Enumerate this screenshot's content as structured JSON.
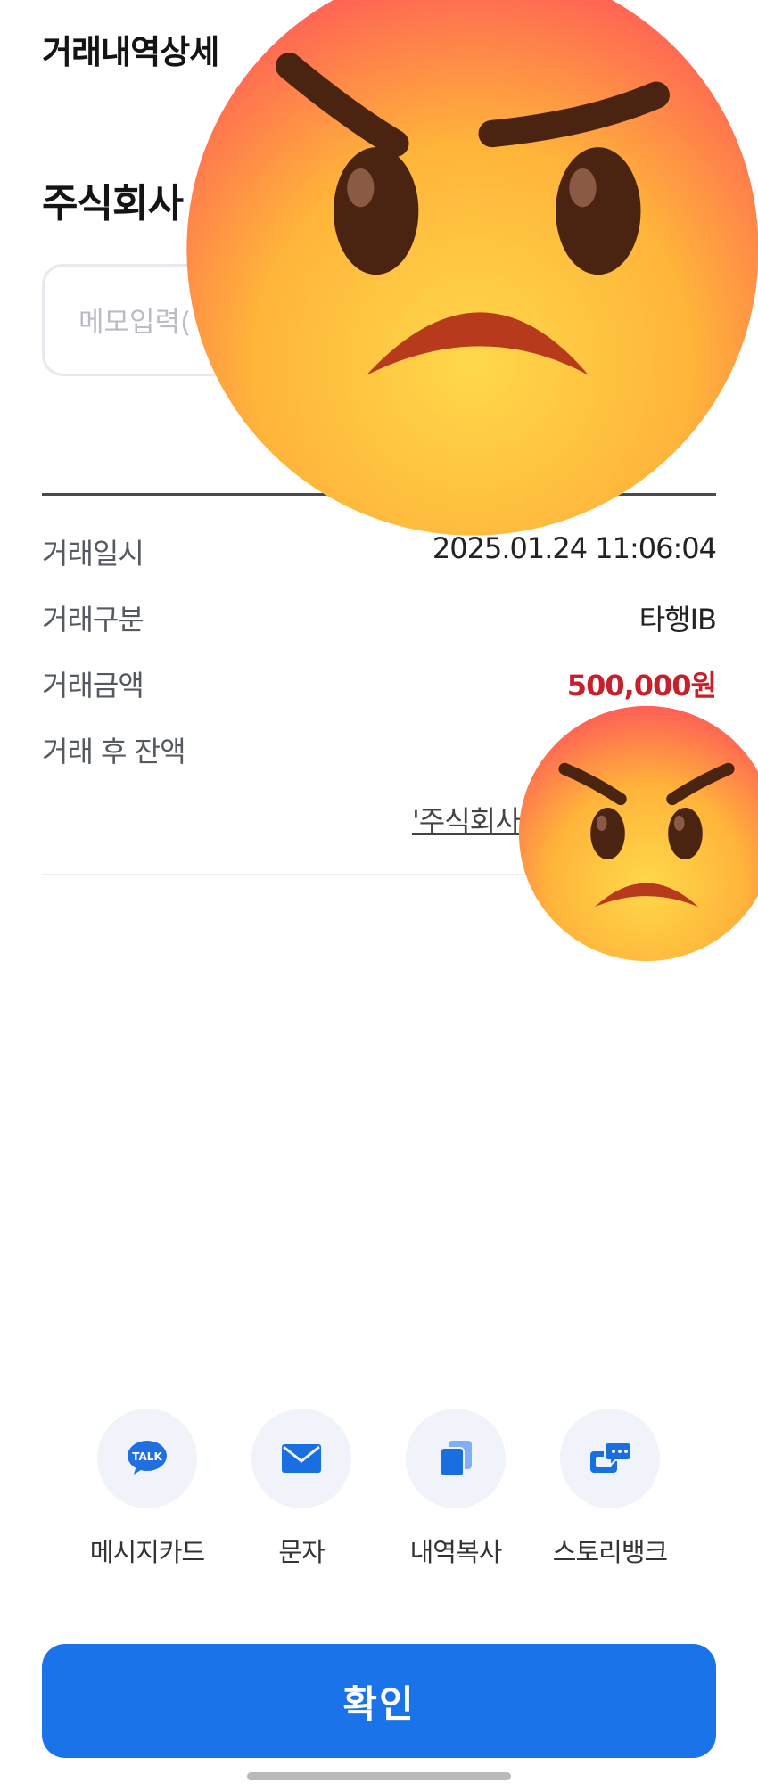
{
  "header": {
    "title": "거래내역상세"
  },
  "account": {
    "title_visible": "주식회사"
  },
  "memo": {
    "placeholder": "메모입력("
  },
  "details": [
    {
      "label": "거래일시",
      "value": "2025.01.24  11:06:04"
    },
    {
      "label": "거래구분",
      "value": "타행IB"
    },
    {
      "label": "거래금액",
      "value": "500,000원"
    },
    {
      "label": "거래 후 잔액",
      "value": ""
    }
  ],
  "memo_link_text": "'주식회사",
  "share": {
    "items": [
      {
        "label": "메시지카드",
        "icon": "kakao-talk-icon",
        "icon_text": "TALK"
      },
      {
        "label": "문자",
        "icon": "mail-icon"
      },
      {
        "label": "내역복사",
        "icon": "copy-icon"
      },
      {
        "label": "스토리뱅크",
        "icon": "storybank-icon"
      }
    ]
  },
  "confirm_label": "확인",
  "colors": {
    "accent": "#1a73e8",
    "amount_red": "#c7202b",
    "icon_blue": "#1a6fe0",
    "kakao_blue": "#1f6fe0"
  },
  "overlays": [
    "angry-face-emoji",
    "angry-face-emoji"
  ]
}
